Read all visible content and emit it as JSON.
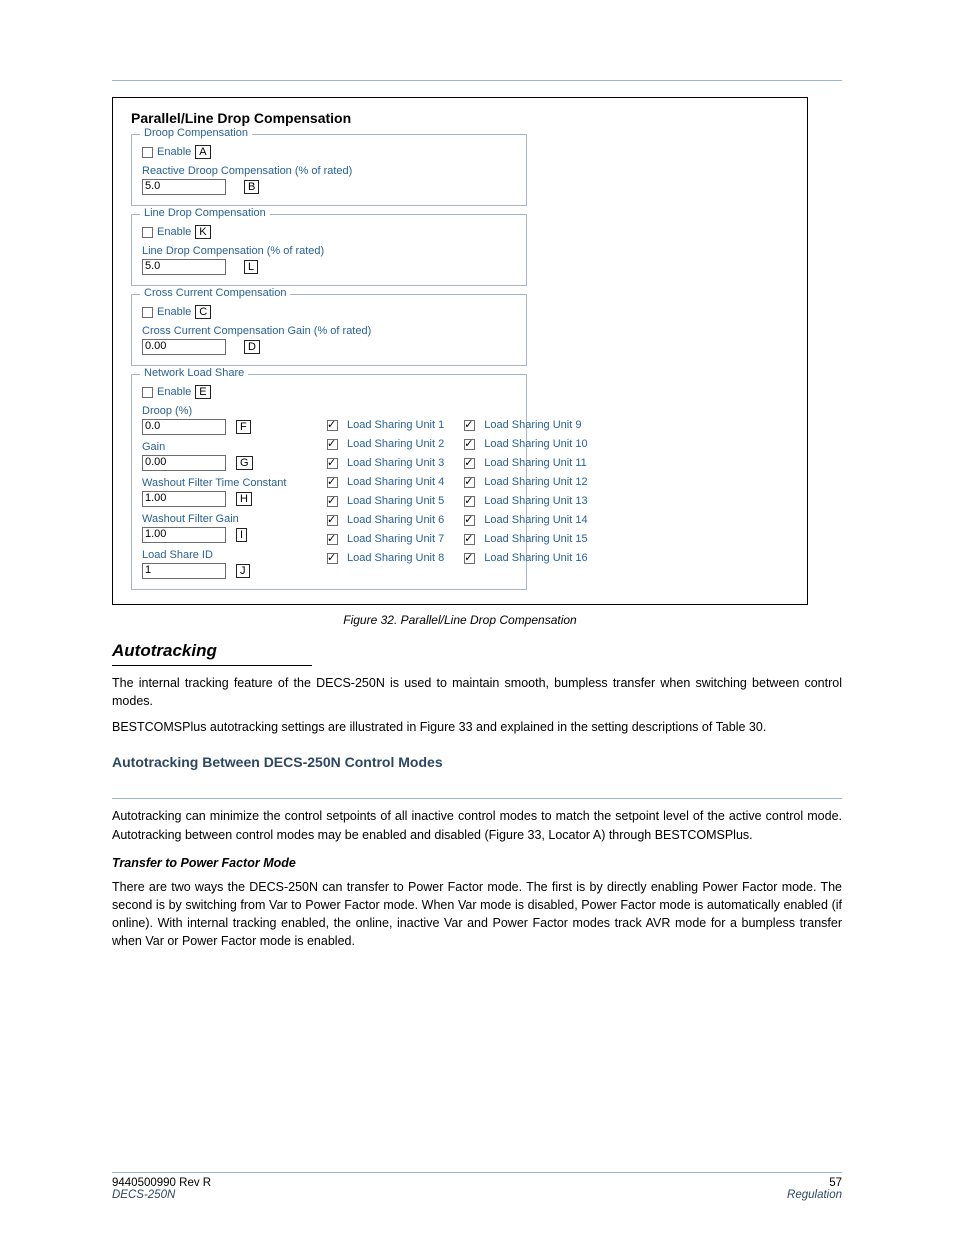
{
  "figure": {
    "title": "Parallel/Line Drop Compensation",
    "droop": {
      "legend": "Droop Compensation",
      "enable_label": "Enable",
      "tag": "A",
      "caption": "Reactive Droop Compensation (% of rated)",
      "value": "5.0",
      "value_tag": "B"
    },
    "linedrop": {
      "legend": "Line Drop Compensation",
      "enable_label": "Enable",
      "tag": "K",
      "caption": "Line Drop Compensation (% of rated)",
      "value": "5.0",
      "value_tag": "L"
    },
    "cross": {
      "legend": "Cross Current Compensation",
      "enable_label": "Enable",
      "tag": "C",
      "caption": "Cross Current Compensation Gain (% of rated)",
      "value": "0.00",
      "value_tag": "D"
    },
    "nls": {
      "legend": "Network Load Share",
      "enable_label": "Enable",
      "tag": "E",
      "droop_label": "Droop (%)",
      "droop_value": "0.0",
      "droop_tag": "F",
      "gain_label": "Gain",
      "gain_value": "0.00",
      "gain_tag": "G",
      "washout_tc_label": "Washout Filter Time Constant",
      "washout_tc_value": "1.00",
      "washout_tc_tag": "H",
      "washout_gain_label": "Washout Filter Gain",
      "washout_gain_value": "1.00",
      "washout_gain_tag": "I",
      "loadshare_id_label": "Load Share ID",
      "loadshare_id_value": "1",
      "loadshare_id_tag": "J",
      "units_left": [
        "Load Sharing Unit 1",
        "Load Sharing Unit 2",
        "Load Sharing Unit 3",
        "Load Sharing Unit 4",
        "Load Sharing Unit 5",
        "Load Sharing Unit 6",
        "Load Sharing Unit 7",
        "Load Sharing Unit 8"
      ],
      "units_right": [
        "Load Sharing Unit 9",
        "Load Sharing Unit 10",
        "Load Sharing Unit 11",
        "Load Sharing Unit 12",
        "Load Sharing Unit 13",
        "Load Sharing Unit 14",
        "Load Sharing Unit 15",
        "Load Sharing Unit 16"
      ]
    },
    "fig_caption": "Figure 32. Parallel/Line Drop Compensation"
  },
  "section": {
    "h2": "Autotracking",
    "p1": "The internal tracking feature of the DECS-250N is used to maintain smooth, bumpless transfer when switching between control modes.",
    "p2": "BESTCOMSPlus autotracking settings are illustrated in Figure 33 and explained in the setting descriptions of Table 30.",
    "h3": "Autotracking Between DECS-250N Control Modes",
    "p3": "Autotracking can minimize the control setpoints of all inactive control modes to match the setpoint level of the active control mode. Autotracking between control modes may be enabled and disabled (Figure 33, Locator A) through BESTCOMSPlus.",
    "h4": "Transfer to Power Factor Mode",
    "p4": "There are two ways the DECS-250N can transfer to Power Factor mode. The first is by directly enabling Power Factor mode. The second is by switching from Var to Power Factor mode. When Var mode is disabled, Power Factor mode is automatically enabled (if online). With internal tracking enabled, the online, inactive Var and Power Factor modes track AVR mode for a bumpless transfer when Var or Power Factor mode is enabled."
  },
  "footer": {
    "left": "9440500990 Rev R",
    "right": "57",
    "brand": "DECS-250N",
    "label": "Regulation"
  }
}
